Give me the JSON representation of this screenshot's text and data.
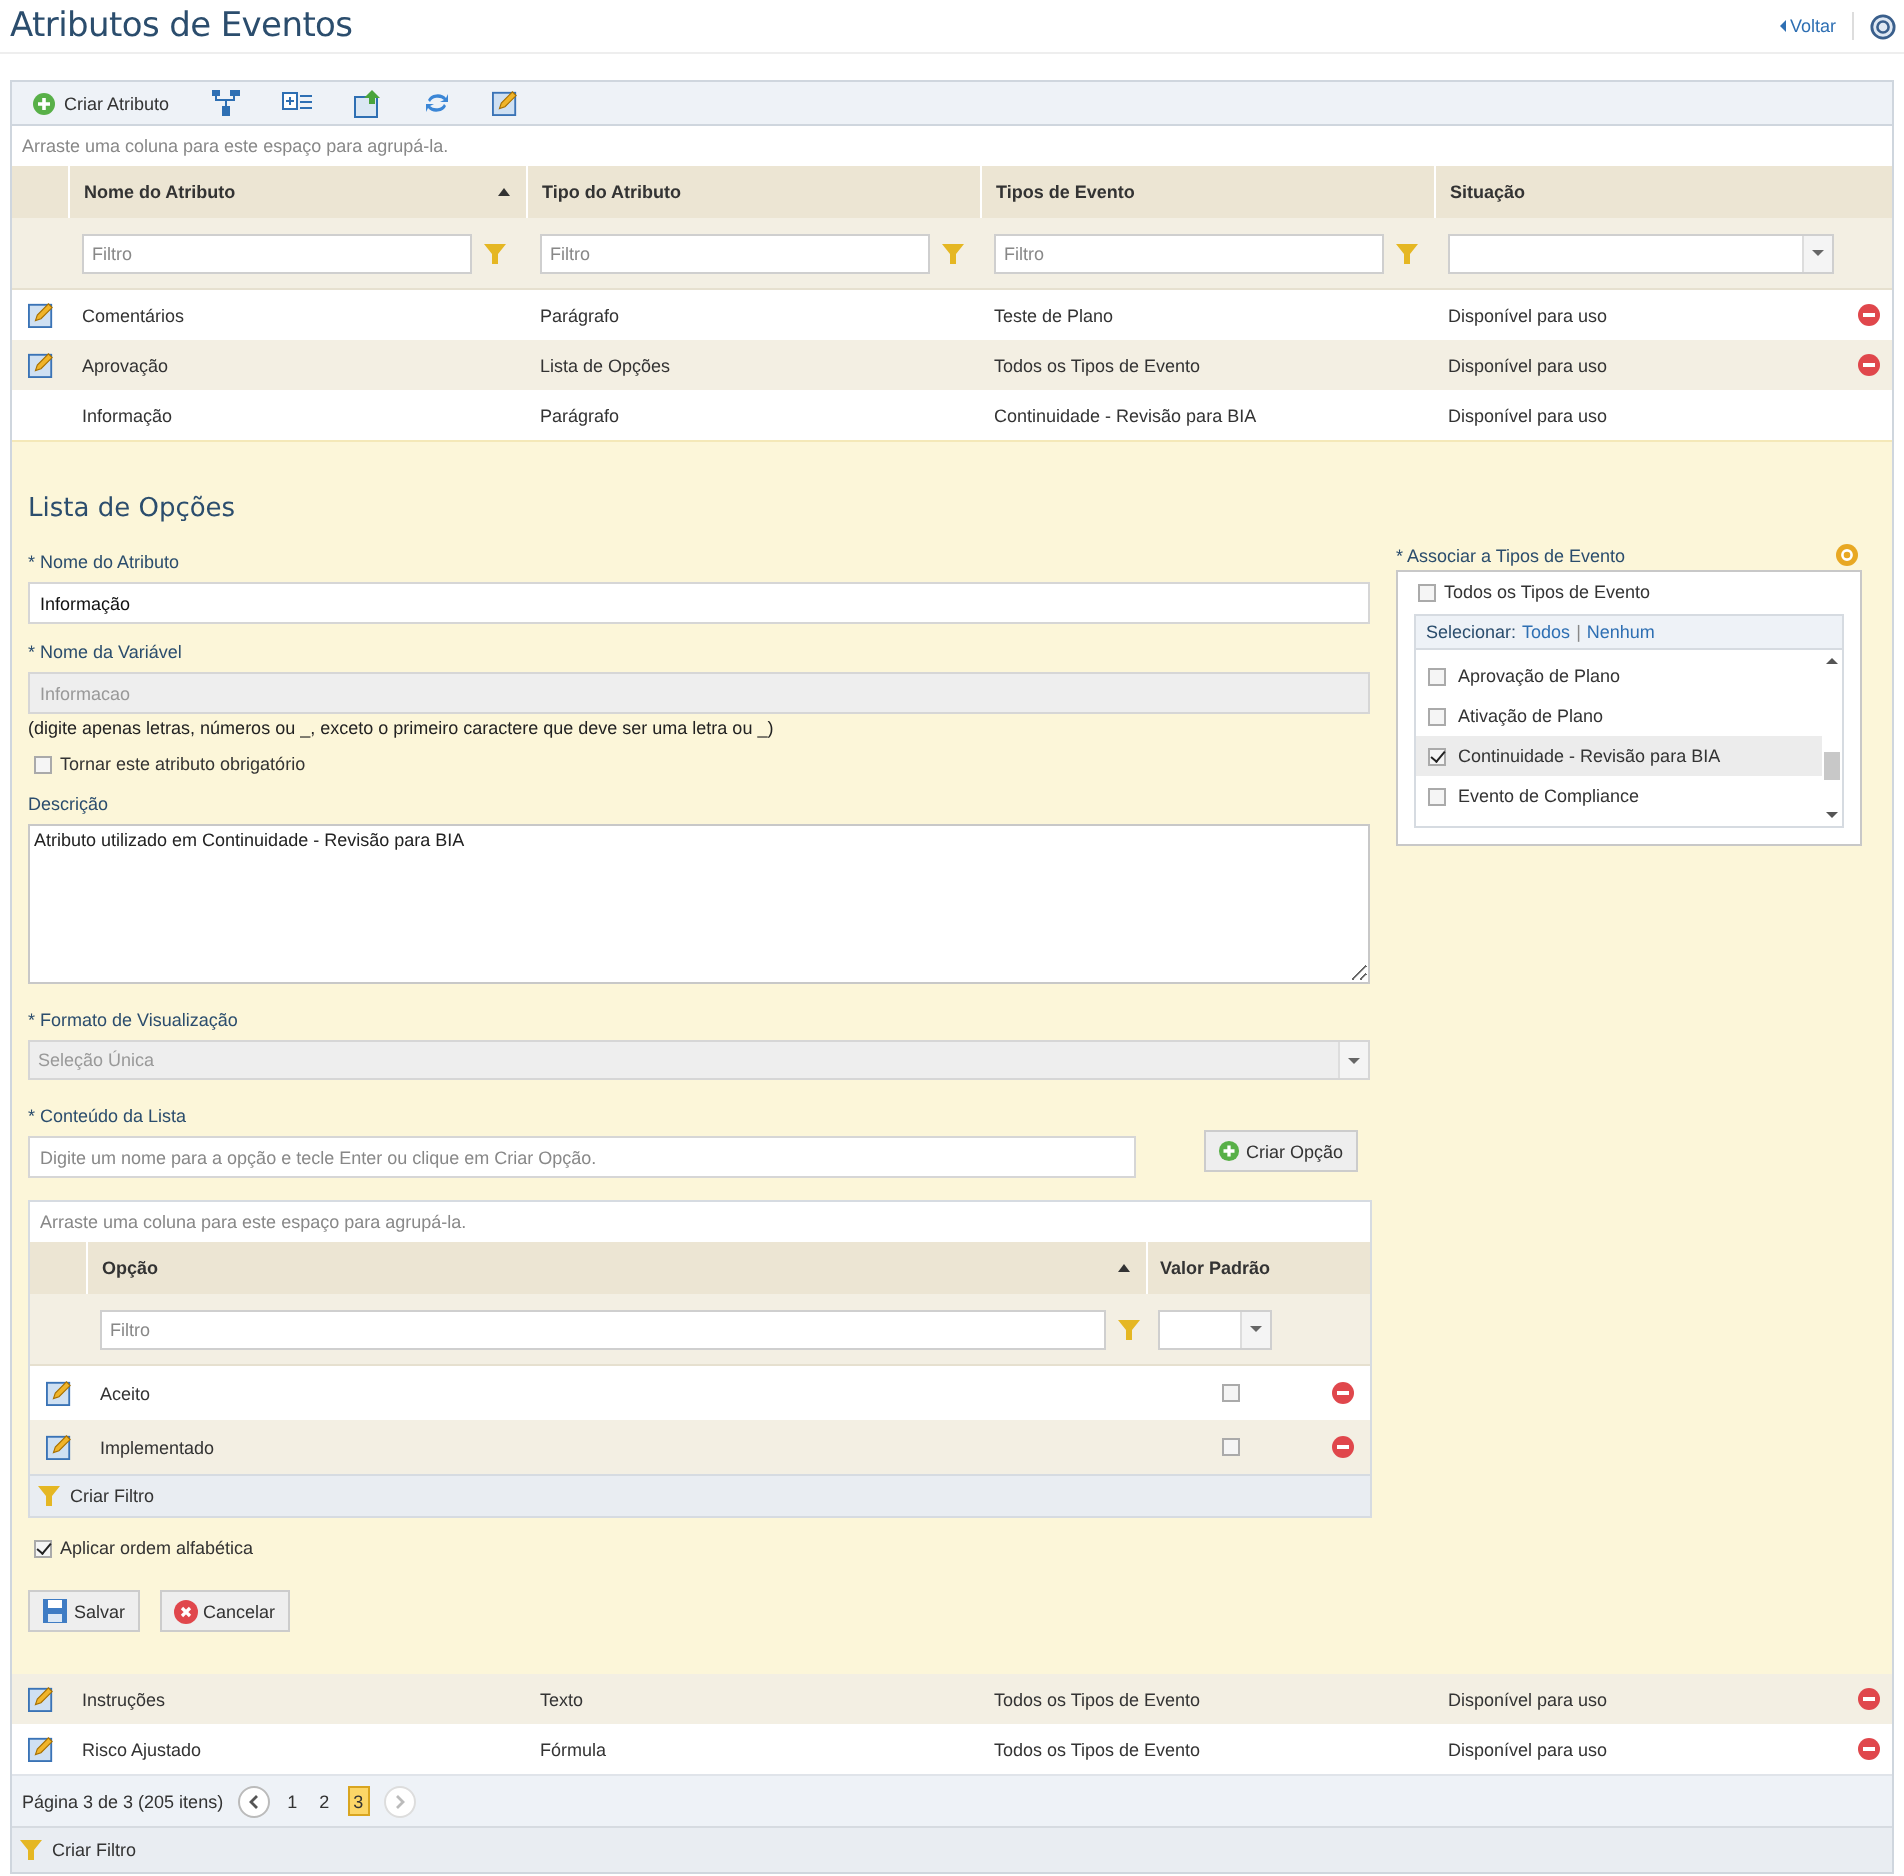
{
  "page": {
    "title": "Atributos de Eventos",
    "back_link": "Voltar"
  },
  "toolbar": {
    "create_button": "Criar Atributo"
  },
  "grid": {
    "group_hint": "Arraste uma coluna para este espaço para agrupá-la.",
    "columns": [
      {
        "label": "Nome do Atributo",
        "sorted": true
      },
      {
        "label": "Tipo do Atributo",
        "sorted": false
      },
      {
        "label": "Tipos de Evento",
        "sorted": false
      },
      {
        "label": "Situação",
        "sorted": false
      }
    ],
    "filters": [
      {
        "kind": "text",
        "placeholder": "Filtro"
      },
      {
        "kind": "text",
        "placeholder": "Filtro"
      },
      {
        "kind": "text",
        "placeholder": "Filtro"
      },
      {
        "kind": "select"
      }
    ],
    "rows": [
      {
        "name": "Comentários",
        "type": "Parágrafo",
        "event_types": "Teste de Plano",
        "status": "Disponível para uso",
        "editing": false
      },
      {
        "name": "Aprovação",
        "type": "Lista de Opções",
        "event_types": "Todos os Tipos de Evento",
        "status": "Disponível para uso",
        "editing": false
      },
      {
        "name": "Informação",
        "type": "Parágrafo",
        "event_types": "Continuidade - Revisão para BIA",
        "status": "Disponível para uso",
        "editing": true
      },
      {
        "name": "Instruções",
        "type": "Texto",
        "event_types": "Todos os Tipos de Evento",
        "status": "Disponível para uso",
        "editing": false
      },
      {
        "name": "Risco Ajustado",
        "type": "Fórmula",
        "event_types": "Todos os Tipos de Evento",
        "status": "Disponível para uso",
        "editing": false
      }
    ],
    "pager": {
      "summary": "Página 3 de 3 (205 itens)",
      "pages": [
        {
          "label": "1",
          "selected": false
        },
        {
          "label": "2",
          "selected": false
        },
        {
          "label": "3",
          "selected": true
        }
      ]
    },
    "create_filter": "Criar Filtro"
  },
  "editor": {
    "heading": "Lista de Opções",
    "name_field": {
      "label": "* Nome do Atributo",
      "value": "Informação"
    },
    "variable_field": {
      "label": "* Nome da Variável",
      "value": "Informacao",
      "disabled": true,
      "hint": "(digite apenas letras, números ou _, exceto o primeiro caractere que deve ser uma letra ou _)"
    },
    "required_checkbox": {
      "label": "Tornar este atributo obrigatório",
      "checked": false
    },
    "description": {
      "label": "Descrição",
      "value": "Atributo utilizado em Continuidade - Revisão para BIA"
    },
    "display_format": {
      "label": "* Formato de Visualização",
      "value": "Seleção Única",
      "disabled": true
    },
    "list_content": {
      "label": "* Conteúdo da Lista",
      "placeholder": "Digite um nome para a opção e tecle Enter ou clique em Criar Opção.",
      "button": "Criar Opção"
    },
    "options_grid": {
      "group_hint": "Arraste uma coluna para este espaço para agrupá-la.",
      "columns": [
        {
          "label": "Opção",
          "sorted": true
        },
        {
          "label": "Valor Padrão",
          "sorted": false
        }
      ],
      "filter_placeholder": "Filtro",
      "rows": [
        {
          "name": "Aceito",
          "default": false
        },
        {
          "name": "Implementado",
          "default": false
        }
      ],
      "create_filter": "Criar Filtro"
    },
    "alphabetical_checkbox": {
      "label": "Aplicar ordem alfabética",
      "checked": true
    },
    "save_button": "Salvar",
    "cancel_button": "Cancelar",
    "event_types": {
      "label": "* Associar a Tipos de Evento",
      "all_checkbox": {
        "label": "Todos os Tipos de Evento",
        "checked": false
      },
      "select_label": "Selecionar:",
      "select_all": "Todos",
      "select_separator": "|",
      "select_none": "Nenhum",
      "items": [
        {
          "label": "Aprovação de Plano",
          "checked": false,
          "selected": false
        },
        {
          "label": "Ativação de Plano",
          "checked": false,
          "selected": false
        },
        {
          "label": "Continuidade - Revisão para BIA",
          "checked": true,
          "selected": true
        },
        {
          "label": "Evento de Compliance",
          "checked": false,
          "selected": false
        }
      ]
    }
  }
}
